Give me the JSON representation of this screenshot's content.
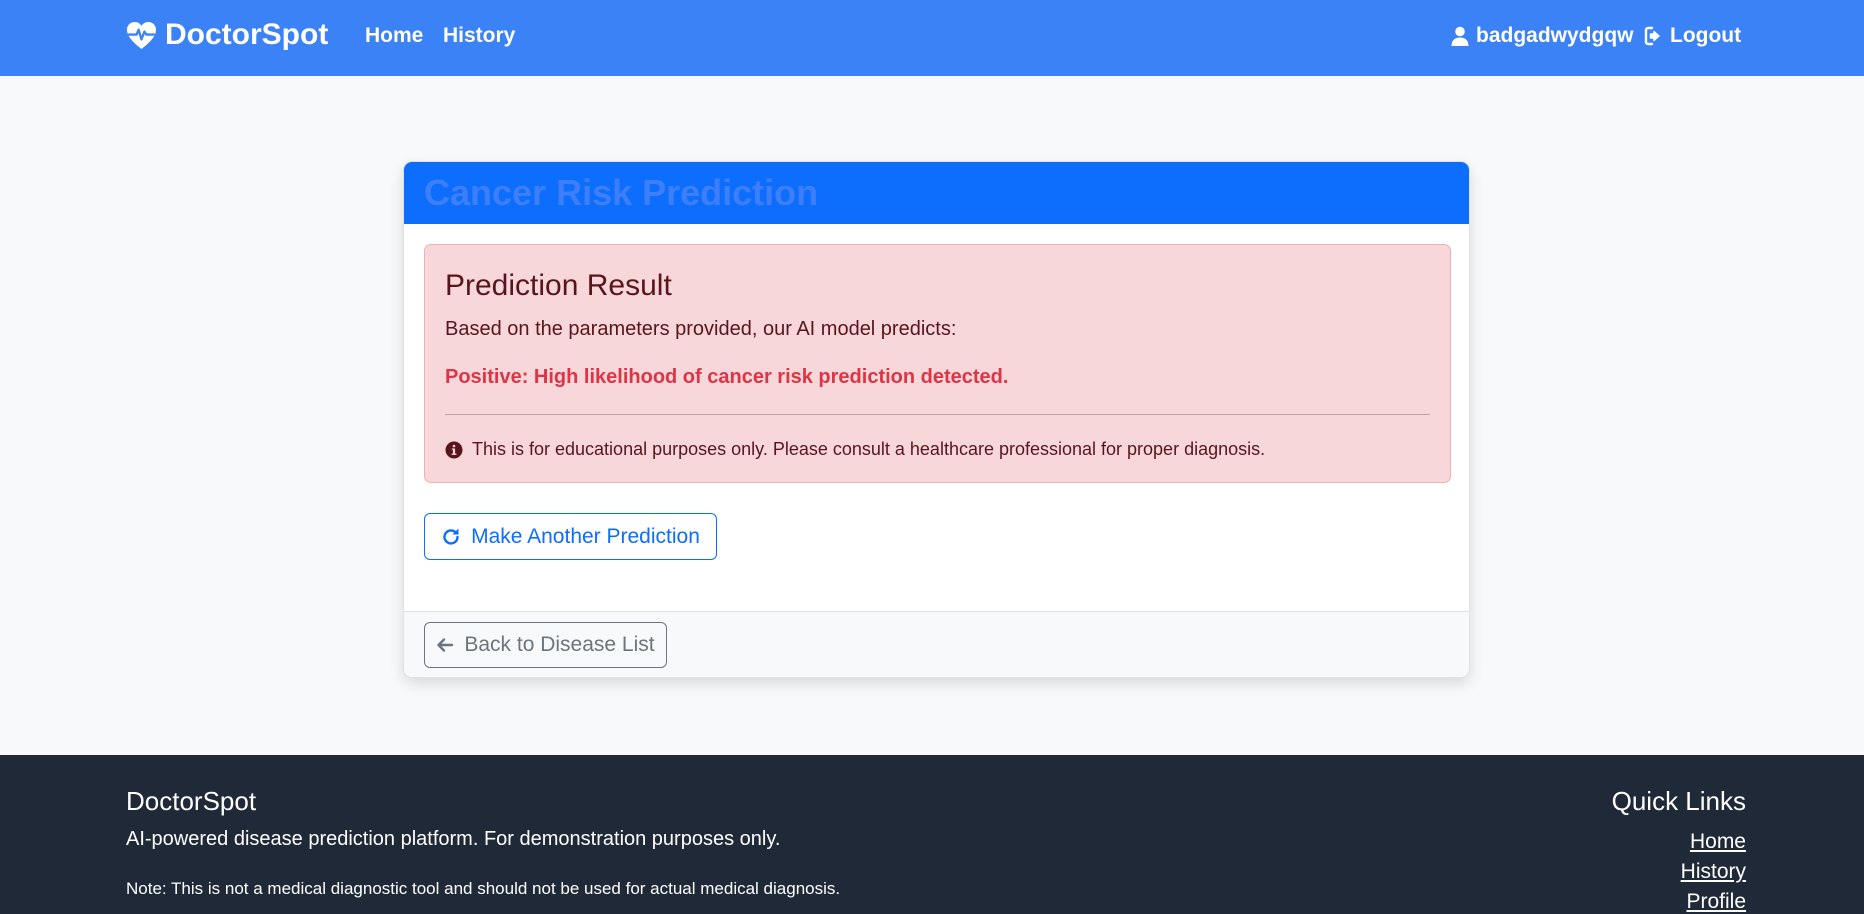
{
  "navbar": {
    "brand": "DoctorSpot",
    "brand_icon": "heart-pulse-icon",
    "links": [
      {
        "label": "Home"
      },
      {
        "label": "History"
      }
    ],
    "username": "badgadwydgqw",
    "logout_label": "Logout",
    "color": "#3b82f6"
  },
  "card": {
    "title": "Cancer Risk Prediction",
    "header_color": "#0d6efd",
    "alert": {
      "heading": "Prediction Result",
      "lead": "Based on the parameters provided, our AI model predicts:",
      "result": "Positive: High likelihood of cancer risk prediction detected.",
      "result_color": "#dc3545",
      "note": "This is for educational purposes only. Please consult a healthcare professional for proper diagnosis.",
      "note_icon": "info-circle-icon"
    },
    "again_button": "Make Another Prediction",
    "back_button": "Back to Disease List"
  },
  "footer": {
    "brand": "DoctorSpot",
    "description": "AI-powered disease prediction platform. For demonstration purposes only.",
    "note": "Note: This is not a medical diagnostic tool and should not be used for actual medical diagnosis.",
    "quick_links_title": "Quick Links",
    "quick_links": [
      {
        "label": "Home"
      },
      {
        "label": "History"
      },
      {
        "label": "Profile"
      }
    ]
  }
}
